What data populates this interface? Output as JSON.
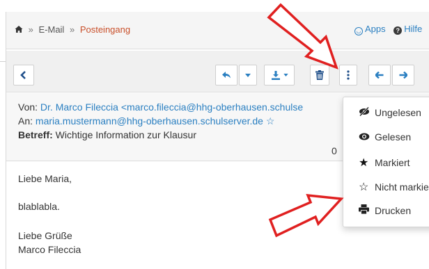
{
  "breadcrumb": {
    "home_icon": "home-icon",
    "separator": "»",
    "email": "E-Mail",
    "current": "Posteingang"
  },
  "toplinks": {
    "apps": "Apps",
    "help": "Hilfe"
  },
  "toolbar": {
    "icons": [
      "chevron-left-icon",
      "reply-icon",
      "caret-down-icon",
      "download-icon",
      "trash-icon",
      "more-vertical-icon",
      "arrow-left-icon",
      "arrow-right-icon"
    ]
  },
  "message": {
    "from_label": "Von:",
    "from_value": "Dr. Marco Fileccia <marco.fileccia@hhg-oberhausen.schulse",
    "to_label": "An:",
    "to_value": "maria.mustermann@hhg-oberhausen.schulserver.de ☆",
    "subject_label": "Betreff:",
    "subject_value": "Wichtige Information zur Klausur",
    "truncated_char": "0",
    "body_lines": [
      "Liebe Maria,",
      "blablabla.",
      "Liebe Grüße",
      "Marco Fileccia"
    ]
  },
  "menu": {
    "items": [
      {
        "label": "Ungelesen",
        "icon": "eye-slash-icon"
      },
      {
        "label": "Gelesen",
        "icon": "eye-icon"
      },
      {
        "label": "Markiert",
        "icon": "star-filled-icon"
      },
      {
        "label": "Nicht markier",
        "icon": "star-outline-icon"
      },
      {
        "label": "Drucken",
        "icon": "print-icon"
      }
    ]
  },
  "colors": {
    "link": "#2a7fc1",
    "breadcrumb_current": "#c9502b",
    "annotation_arrow": "#e02020"
  }
}
